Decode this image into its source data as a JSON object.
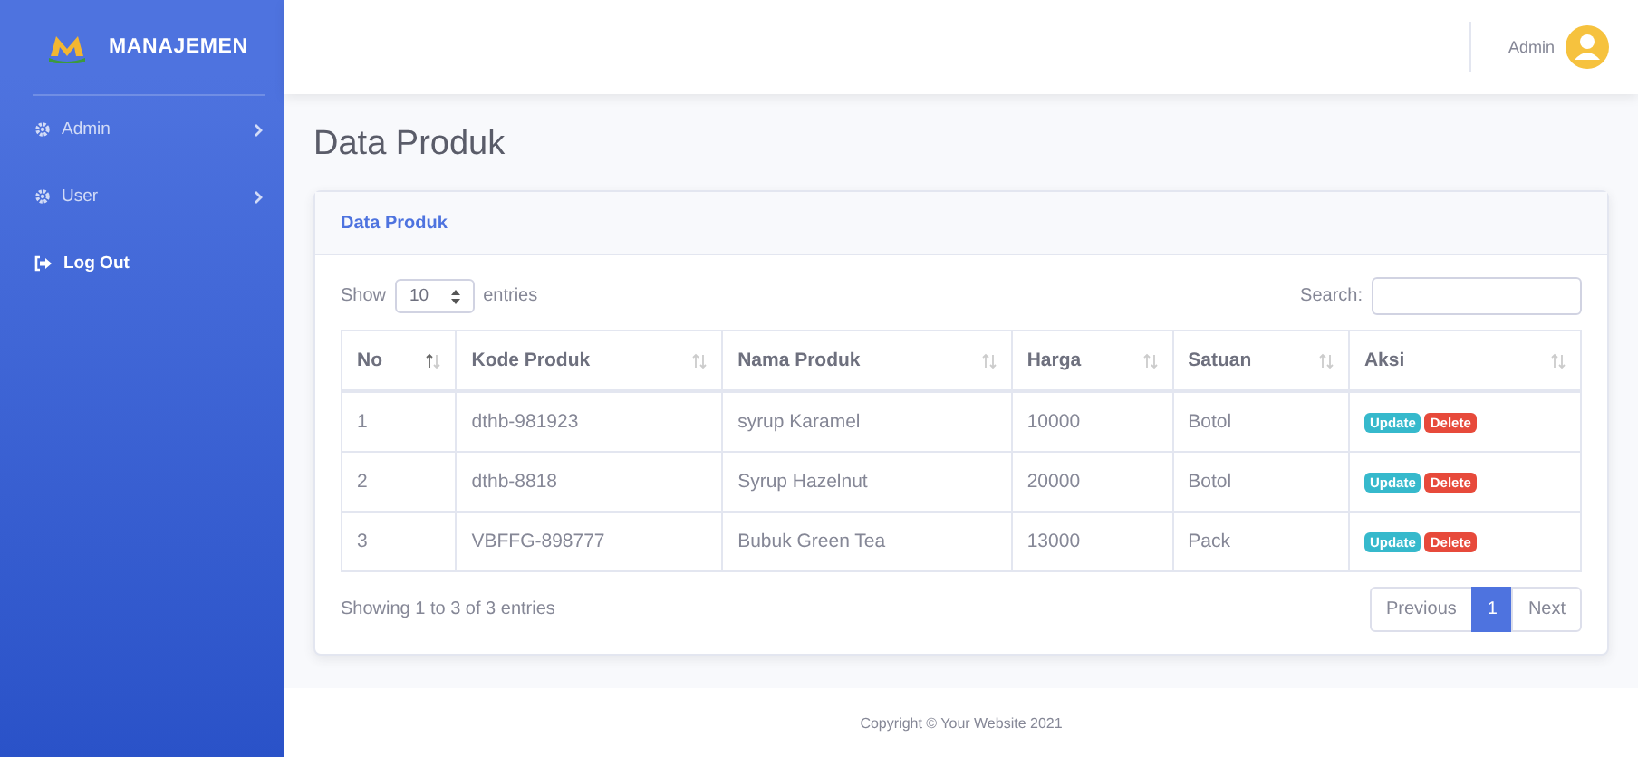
{
  "sidebar": {
    "brand": "MANAJEMEN",
    "items": [
      {
        "label": "Admin",
        "kind": "gear",
        "submenu": true,
        "bold": false
      },
      {
        "label": "User",
        "kind": "gear",
        "submenu": true,
        "bold": false
      },
      {
        "label": "Log Out",
        "kind": "logout",
        "submenu": false,
        "bold": true
      }
    ]
  },
  "topbar": {
    "user": "Admin"
  },
  "page_title": "Data Produk",
  "card": {
    "title": "Data Produk",
    "length": {
      "before": "Show",
      "value": "10",
      "after": "entries"
    },
    "search": {
      "label": "Search:"
    },
    "table": {
      "columns": [
        {
          "label": "No",
          "sorted": true
        },
        {
          "label": "Kode Produk",
          "sorted": false
        },
        {
          "label": "Nama Produk",
          "sorted": false
        },
        {
          "label": "Harga",
          "sorted": false
        },
        {
          "label": "Satuan",
          "sorted": false
        },
        {
          "label": "Aksi",
          "sorted": false
        }
      ],
      "rows": [
        {
          "cells": [
            "1",
            "dthb-981923",
            "syrup Karamel",
            "10000",
            "Botol"
          ],
          "actions": [
            "Update",
            "Delete"
          ]
        },
        {
          "cells": [
            "2",
            "dthb-8818",
            "Syrup Hazelnut",
            "20000",
            "Botol"
          ],
          "actions": [
            "Update",
            "Delete"
          ]
        },
        {
          "cells": [
            "3",
            "VBFFG-898777",
            "Bubuk Green Tea",
            "13000",
            "Pack"
          ],
          "actions": [
            "Update",
            "Delete"
          ]
        }
      ]
    },
    "info": "Showing 1 to 3 of 3 entries",
    "pagination": [
      {
        "label": "Previous",
        "selected": false
      },
      {
        "label": "1",
        "selected": true
      },
      {
        "label": "Next",
        "selected": false
      }
    ]
  },
  "footer": "Copyright © Your Website 2021"
}
